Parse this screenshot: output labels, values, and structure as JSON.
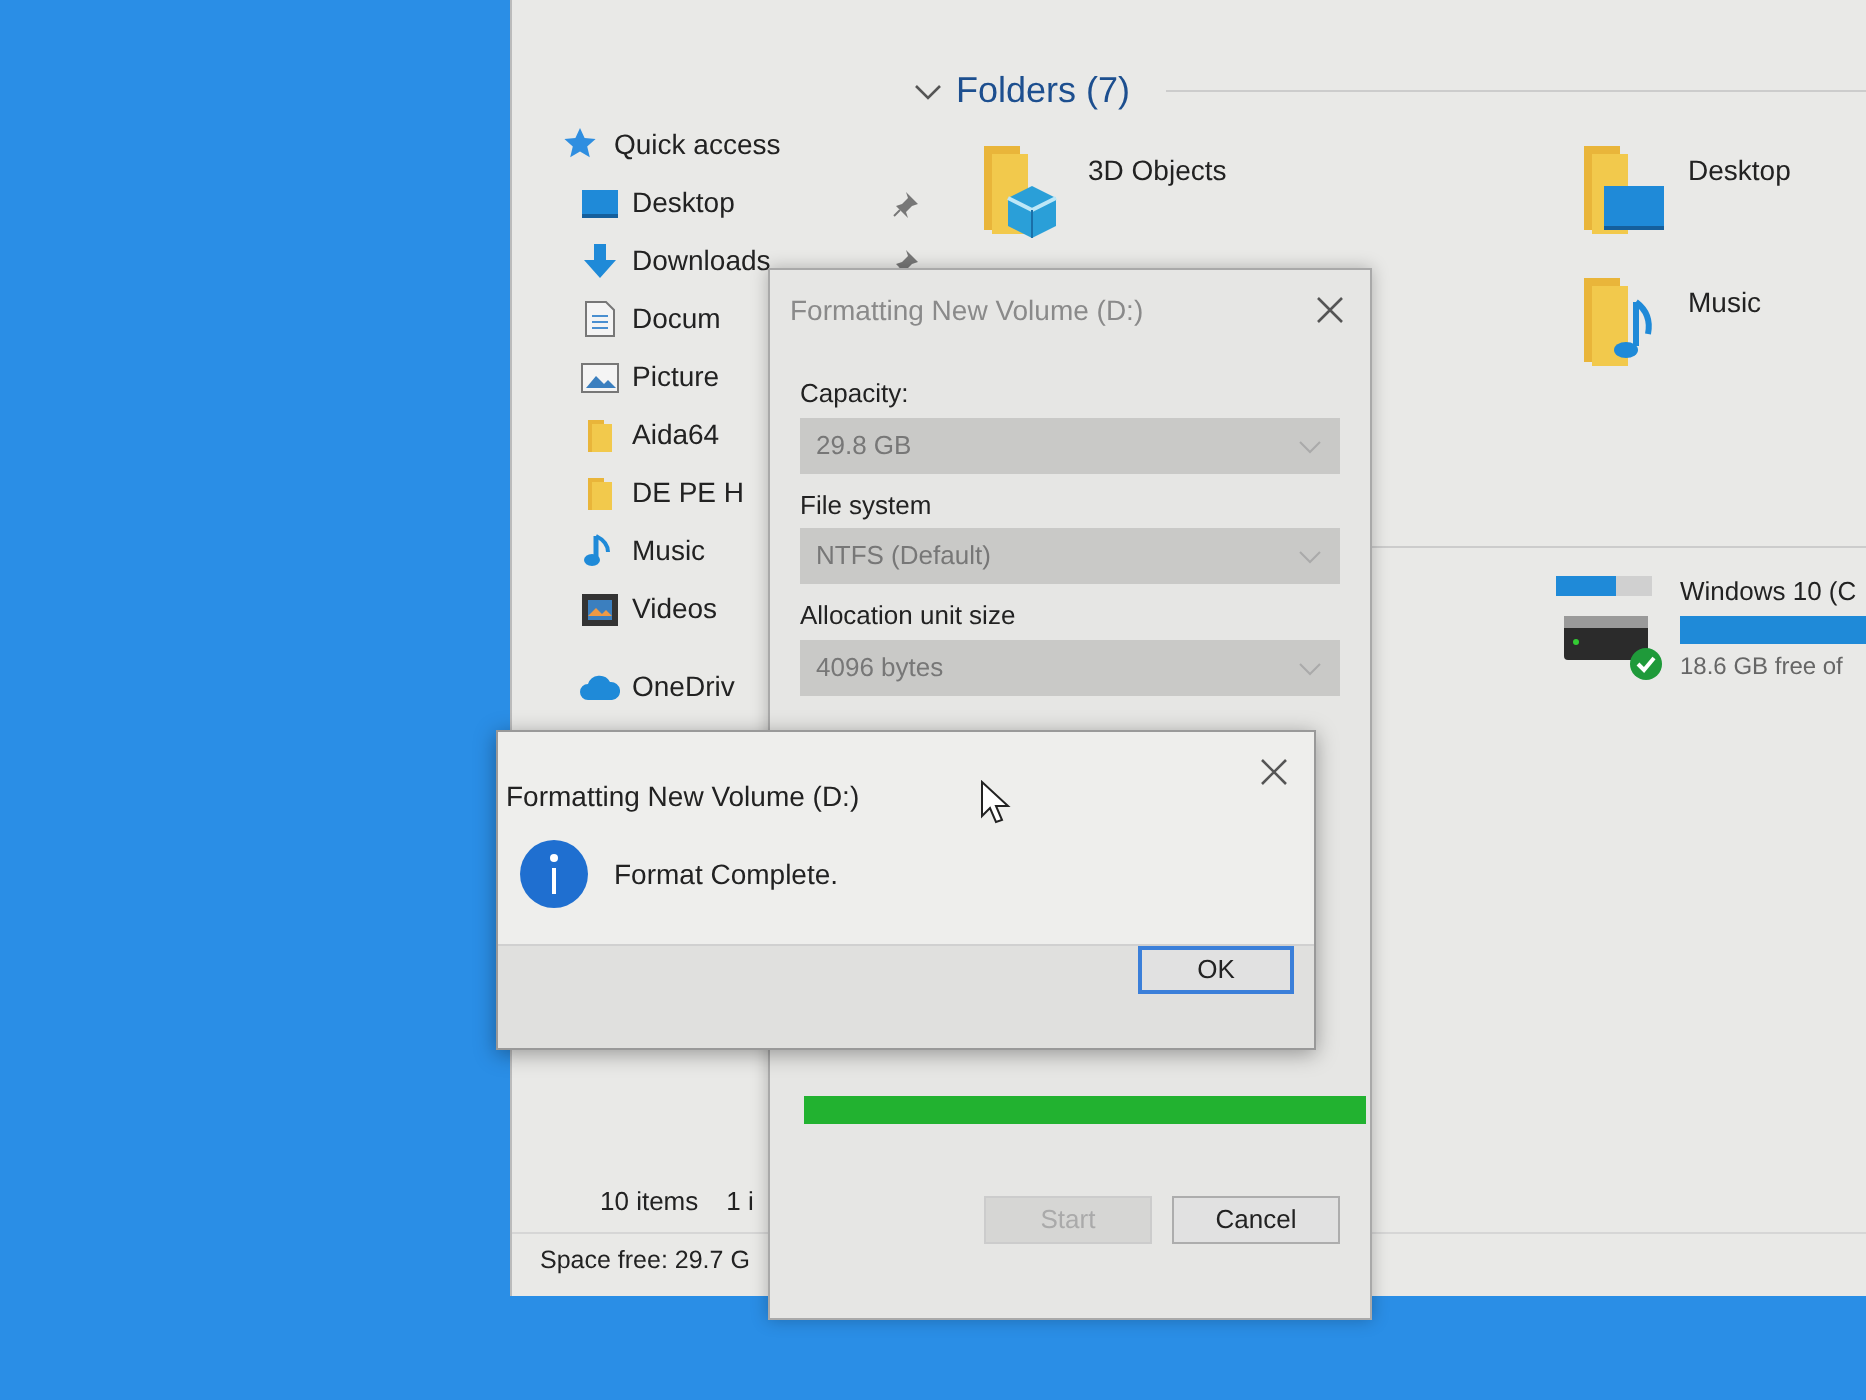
{
  "explorer": {
    "sidebar": [
      {
        "label": "Quick access",
        "kind": "star"
      },
      {
        "label": "Desktop",
        "kind": "desktop",
        "pinned": true
      },
      {
        "label": "Downloads",
        "kind": "download",
        "pinned": true
      },
      {
        "label": "Docum",
        "kind": "document"
      },
      {
        "label": "Picture",
        "kind": "picture"
      },
      {
        "label": "Aida64",
        "kind": "folder"
      },
      {
        "label": "DE PE H",
        "kind": "folder"
      },
      {
        "label": "Music",
        "kind": "music"
      },
      {
        "label": "Videos",
        "kind": "video"
      },
      {
        "label": "OneDriv",
        "kind": "cloud"
      }
    ],
    "folders_header": "Folders (7)",
    "folder_columns": [
      [
        {
          "name": "3D Objects",
          "kind": "cube"
        }
      ],
      [
        {
          "name": "Desktop",
          "kind": "desktop"
        },
        {
          "name": "Music",
          "kind": "music"
        }
      ]
    ],
    "drives": [
      {
        "name": "Windows 10 (C",
        "level": 0.8,
        "free": "18.6 GB free of"
      }
    ],
    "status_bar": [
      "10 items",
      "1 i"
    ],
    "space_free": "Space free: 29.7 G"
  },
  "format_dialog": {
    "title": "Formatting New Volume (D:)",
    "fields": [
      {
        "label": "Capacity:",
        "value": "29.8 GB"
      },
      {
        "label": "File system",
        "value": "NTFS (Default)"
      },
      {
        "label": "Allocation unit size",
        "value": "4096 bytes"
      }
    ],
    "progress": {
      "level": 1
    },
    "buttons": [
      {
        "label": "Start",
        "disabled": true
      },
      {
        "label": "Cancel",
        "disabled": false
      }
    ]
  },
  "message_box": {
    "title": "Formatting New Volume (D:)",
    "message": "Format Complete.",
    "buttons": [
      {
        "label": "OK",
        "default": true
      }
    ]
  }
}
